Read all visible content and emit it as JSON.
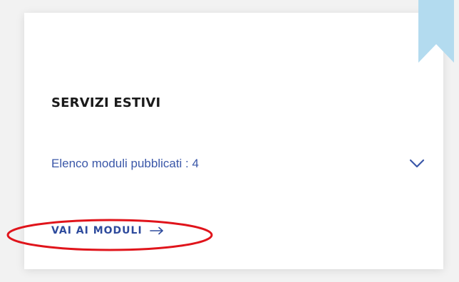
{
  "card": {
    "title": "SERVIZI ESTIVI",
    "modules_label": "Elenco moduli pubblicati : 4",
    "cta_label": "VAI AI MODULI"
  },
  "icons": {
    "bookmark": "bookmark-icon",
    "expand": "chevron-down-icon",
    "cta_arrow": "arrow-right-icon"
  },
  "colors": {
    "bookmark": "#b3dbef",
    "link": "#3a57a8",
    "cta": "#2e4b9d",
    "annotation": "#e0141b"
  }
}
